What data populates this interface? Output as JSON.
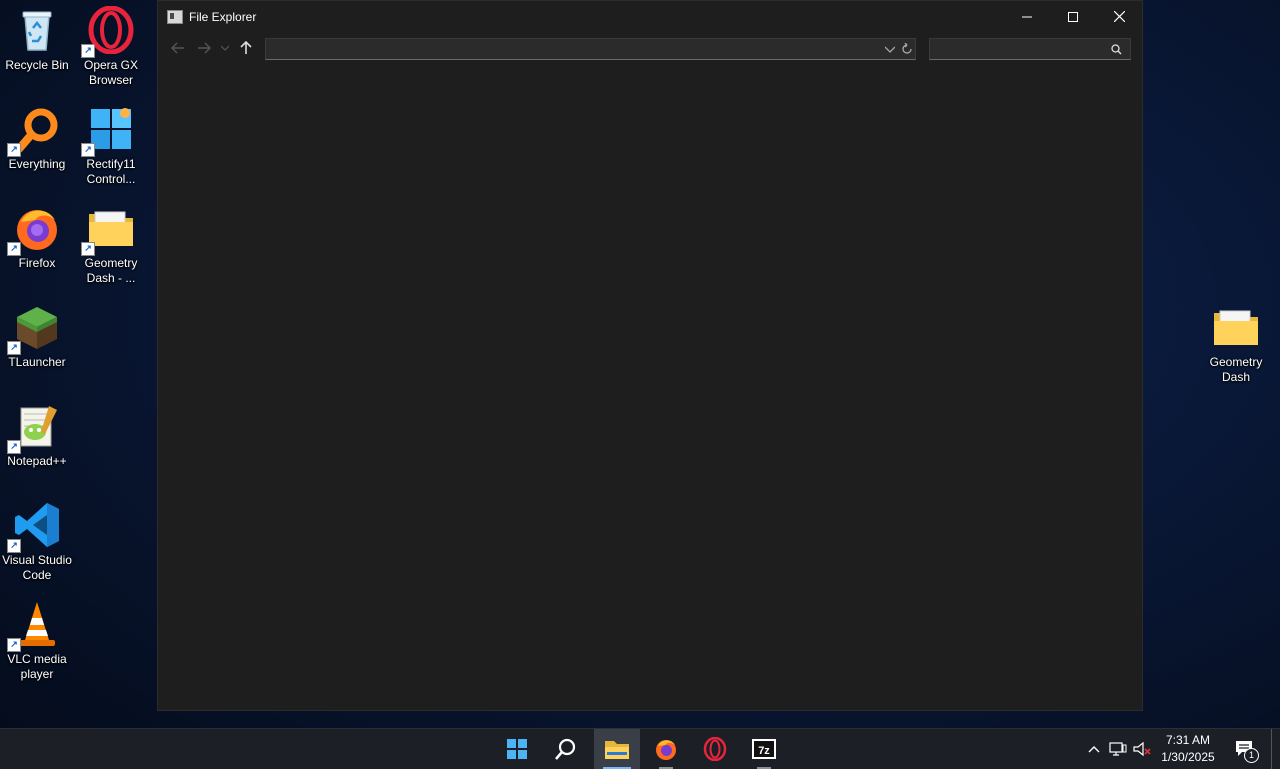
{
  "desktop": {
    "left_column": [
      {
        "id": "recycle-bin",
        "label": "Recycle Bin",
        "icon": "recycle-bin-icon"
      },
      {
        "id": "everything",
        "label": "Everything",
        "icon": "everything-search-icon"
      },
      {
        "id": "firefox",
        "label": "Firefox",
        "icon": "firefox-icon"
      },
      {
        "id": "tlauncher",
        "label": "TLauncher",
        "icon": "minecraft-grass-block-icon"
      },
      {
        "id": "notepadpp",
        "label": "Notepad++",
        "icon": "notepad-plus-plus-icon"
      },
      {
        "id": "vscode",
        "label": "Visual Studio Code",
        "icon": "vscode-icon"
      },
      {
        "id": "vlc",
        "label": "VLC media player",
        "icon": "vlc-cone-icon"
      }
    ],
    "second_column": [
      {
        "id": "opera-gx",
        "label": "Opera GX Browser",
        "icon": "opera-gx-icon"
      },
      {
        "id": "rectify11",
        "label": "Rectify11 Control...",
        "icon": "windows-logo-icon"
      },
      {
        "id": "geometry-dash-shortcut",
        "label": "Geometry Dash - ...",
        "icon": "folder-icon"
      }
    ],
    "right_side": [
      {
        "id": "geometry-dash-folder",
        "label": "Geometry Dash",
        "icon": "folder-icon"
      }
    ]
  },
  "window": {
    "title": "File Explorer",
    "address_value": "",
    "search_placeholder": ""
  },
  "taskbar": {
    "apps": [
      {
        "name": "start",
        "icon": "windows-start-icon"
      },
      {
        "name": "search",
        "icon": "search-icon"
      },
      {
        "name": "file-explorer",
        "icon": "folder-icon",
        "active": true
      },
      {
        "name": "firefox",
        "icon": "firefox-icon",
        "running": true
      },
      {
        "name": "opera-gx",
        "icon": "opera-gx-icon"
      },
      {
        "name": "7zip",
        "icon": "7zip-icon",
        "label": "7z",
        "running": true
      }
    ],
    "time": "7:31 AM",
    "date": "1/30/2025",
    "notification_count": "1"
  },
  "colors": {
    "window_bg": "#1e1e1e",
    "taskbar_bg": "#1c2026",
    "accent": "#7fb2ff",
    "opera_red": "#e8243c"
  }
}
